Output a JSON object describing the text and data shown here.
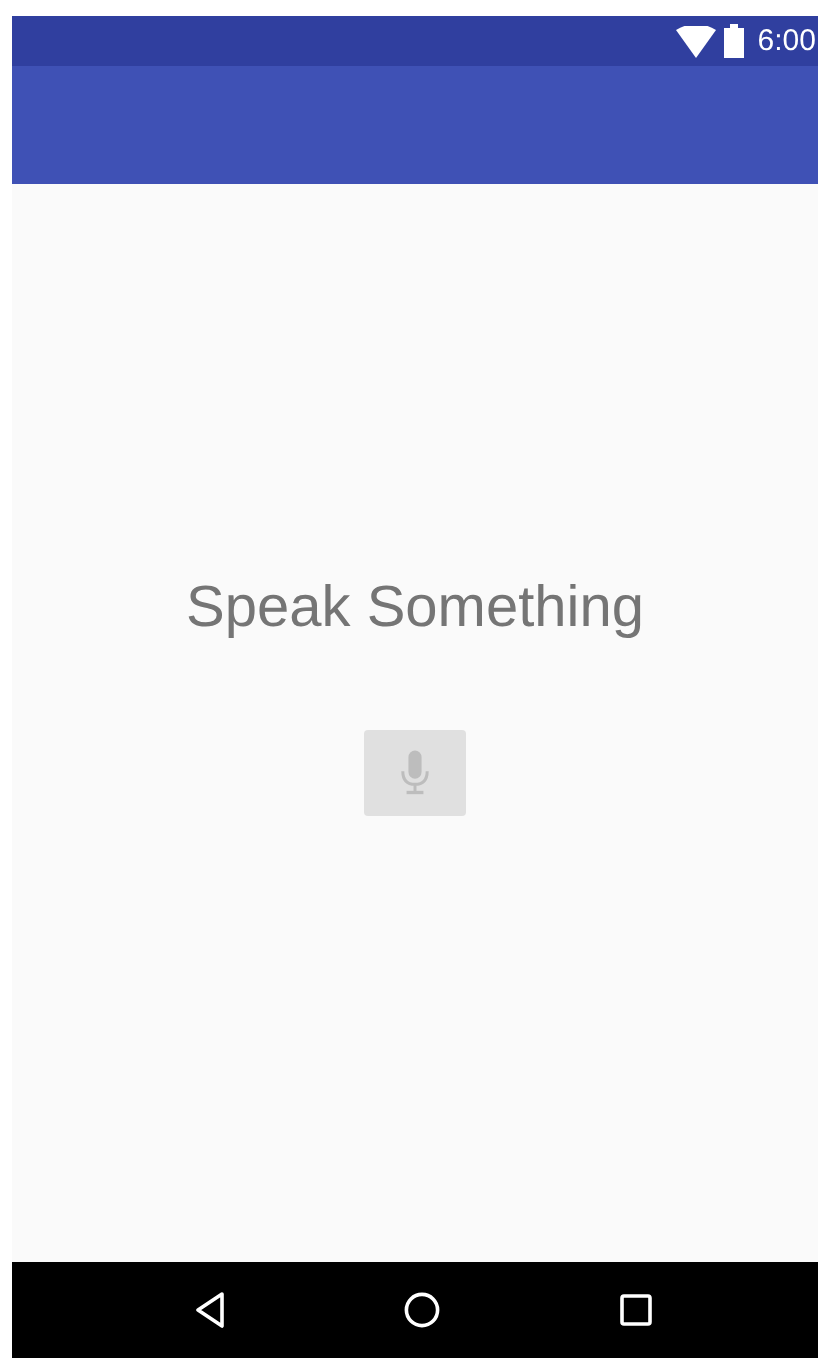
{
  "status_bar": {
    "time": "6:00"
  },
  "prompt": "Speak Something",
  "mic_button": {
    "disabled": true
  }
}
